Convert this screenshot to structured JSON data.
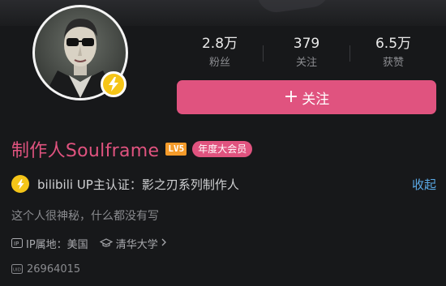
{
  "profile": {
    "name": "制作人Soulframe",
    "level_badge": "LV5",
    "vip_badge": "年度大会员",
    "avatar_desc": "avatar",
    "verified_badge_color": "#f5c518"
  },
  "stats": [
    {
      "value": "2.8万",
      "label": "粉丝"
    },
    {
      "value": "379",
      "label": "关注"
    },
    {
      "value": "6.5万",
      "label": "获赞"
    }
  ],
  "follow_button": {
    "icon": "+",
    "label": "关注"
  },
  "verification": {
    "text": "bilibili UP主认证：影之刃系列制作人",
    "collapse_label": "收起"
  },
  "bio": "这个人很神秘，什么都没有写",
  "meta": {
    "ip_location": "IP属地：美国",
    "school": "清华大学"
  },
  "uid": "26964015",
  "colors": {
    "accent_pink": "#e0537f",
    "link_blue": "#5aa9e6",
    "level_orange": "#f59b2a",
    "background": "#17181a"
  }
}
